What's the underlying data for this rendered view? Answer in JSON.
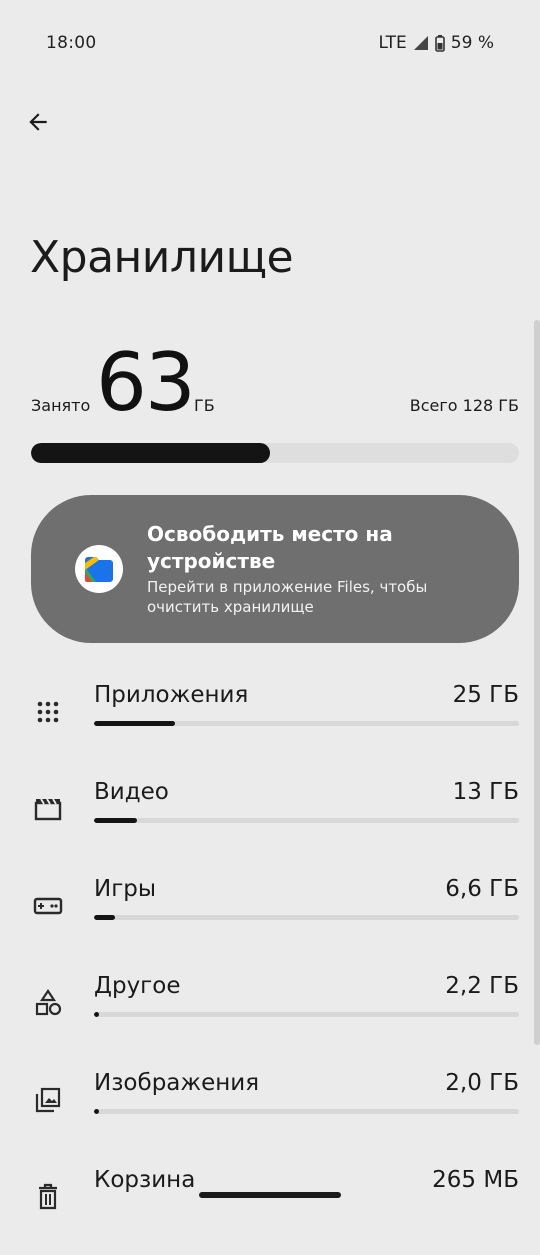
{
  "status_bar": {
    "time": "18:00",
    "network": "LTE",
    "battery": "59 %"
  },
  "page": {
    "title": "Хранилище"
  },
  "storage": {
    "used_label": "Занято",
    "used_value": "63",
    "used_unit": "ГБ",
    "total_label": "Всего 128 ГБ",
    "used_fraction": 0.49
  },
  "promo": {
    "title": "Освободить место на устройстве",
    "subtitle": "Перейти в приложение Files, чтобы очистить хранилище",
    "icon": "files-app-icon"
  },
  "categories": [
    {
      "label": "Приложения",
      "size": "25 ГБ",
      "fraction": 0.19,
      "icon": "apps-grid-icon"
    },
    {
      "label": "Видео",
      "size": "13 ГБ",
      "fraction": 0.1,
      "icon": "video-clapper-icon"
    },
    {
      "label": "Игры",
      "size": "6,6 ГБ",
      "fraction": 0.05,
      "icon": "gamepad-icon"
    },
    {
      "label": "Другое",
      "size": "2,2 ГБ",
      "fraction": 0.012,
      "icon": "shapes-icon"
    },
    {
      "label": "Изображения",
      "size": "2,0 ГБ",
      "fraction": 0.011,
      "icon": "images-icon"
    },
    {
      "label": "Корзина",
      "size": "265 МБ",
      "fraction": 0.002,
      "icon": "trash-icon"
    }
  ],
  "colors": {
    "background": "#ebebeb",
    "bar_fill": "#141414",
    "bar_track": "#d8d8d8",
    "promo_card": "#6f6f6f"
  }
}
